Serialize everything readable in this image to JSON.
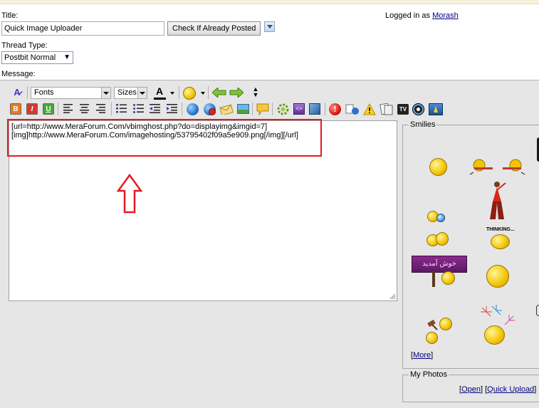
{
  "form": {
    "title_label": "Title:",
    "title_value": "Quick Image Uploader",
    "check_button": "Check If Already Posted",
    "logged_in_prefix": "Logged in as",
    "username": "Morash",
    "thread_type_label": "Thread Type:",
    "thread_type_value": "Postbit Normal",
    "message_label": "Message:"
  },
  "toolbar": {
    "fonts_label": "Fonts",
    "sizes_label": "Sizes",
    "bold": "B",
    "italic": "I",
    "underline": "U",
    "font_color_letter": "A"
  },
  "editor": {
    "line1": "[url=http://www.MeraForum.Com/vbimghost.php?do=displayimg&imgid=7]",
    "line2": "[img]http://www.MeraForum.Com/imagehosting/53795402f09a5e909.png[/img][/url]"
  },
  "smilies": {
    "legend": "Smilies",
    "more_link": "More",
    "thinking_text": "THINKING...",
    "welcome_text": "خوش آمدید"
  },
  "photos": {
    "legend": "My Photos",
    "open_link": "Open",
    "quick_upload_link": "Quick Upload"
  },
  "colors": {
    "highlight": "#e31b23",
    "arrow": "#e31b23",
    "link": "#000080"
  }
}
